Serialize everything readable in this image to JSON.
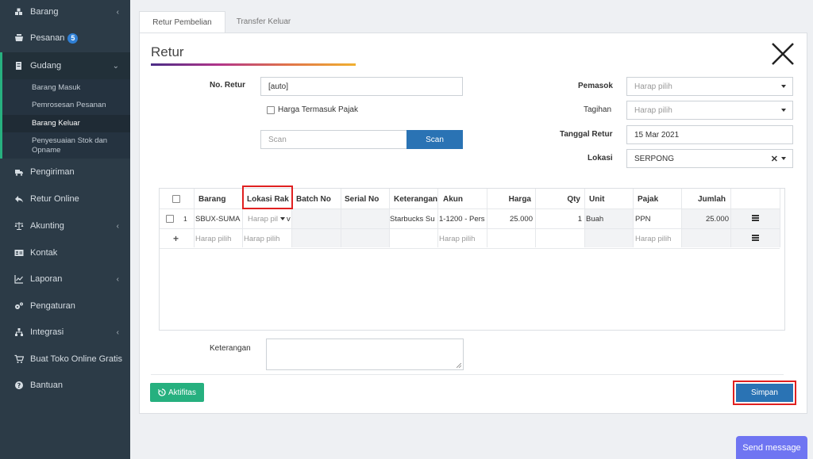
{
  "sidebar": {
    "barang": "Barang",
    "pesanan": "Pesanan",
    "pesanan_badge": "5",
    "gudang": "Gudang",
    "sub": [
      "Barang Masuk",
      "Pemrosesan Pesanan",
      "Barang Keluar",
      "Penyesuaian Stok dan",
      "Opname"
    ],
    "pengiriman": "Pengiriman",
    "retur_online": "Retur Online",
    "akunting": "Akunting",
    "kontak": "Kontak",
    "laporan": "Laporan",
    "pengaturan": "Pengaturan",
    "integrasi": "Integrasi",
    "buat_toko": "Buat Toko Online Gratis",
    "bantuan": "Bantuan"
  },
  "tabs": [
    "Retur Pembelian",
    "Transfer Keluar"
  ],
  "form": {
    "title": "Retur",
    "no_retur_label": "No. Retur",
    "no_retur_value": "[auto]",
    "harga_pajak_label": "Harga Termasuk Pajak",
    "scan_placeholder": "Scan",
    "scan_button": "Scan",
    "pemasok_label": "Pemasok",
    "pemasok_placeholder": "Harap pilih",
    "tagihan_label": "Tagihan",
    "tagihan_placeholder": "Harap pilih",
    "tanggal_label": "Tanggal Retur",
    "tanggal_value": "15 Mar 2021",
    "lokasi_label": "Lokasi",
    "lokasi_value": "SERPONG",
    "keterangan_label": "Keterangan"
  },
  "grid": {
    "headers": [
      "Barang",
      "Lokasi Rak",
      "Batch No",
      "Serial No",
      "Keterangan",
      "Akun",
      "Harga",
      "Qty",
      "Unit",
      "Pajak",
      "Jumlah"
    ],
    "row": {
      "num": "1",
      "barang": "SBUX-SUMA",
      "lokasi": "Harap pil",
      "lokasi_suffix": "v",
      "keterangan": "Starbucks Su",
      "akun": "1-1200 - Pers",
      "harga": "25.000",
      "qty": "1",
      "unit": "Buah",
      "pajak": "PPN",
      "jumlah": "25.000"
    },
    "new_row": {
      "plus": "+",
      "barang": "Harap pilih",
      "lokasi": "Harap pilih",
      "akun": "Harap pilih",
      "pajak": "Harap pilih"
    }
  },
  "buttons": {
    "aktifitas": "Aktifitas",
    "simpan": "Simpan",
    "send_message": "Send message"
  },
  "colors": {
    "sidebar_bg": "#2c3b47",
    "accent_green": "#27b07f",
    "primary_blue": "#2a73b4",
    "highlight_red": "#e02020",
    "send_purple": "#6f75f2"
  }
}
